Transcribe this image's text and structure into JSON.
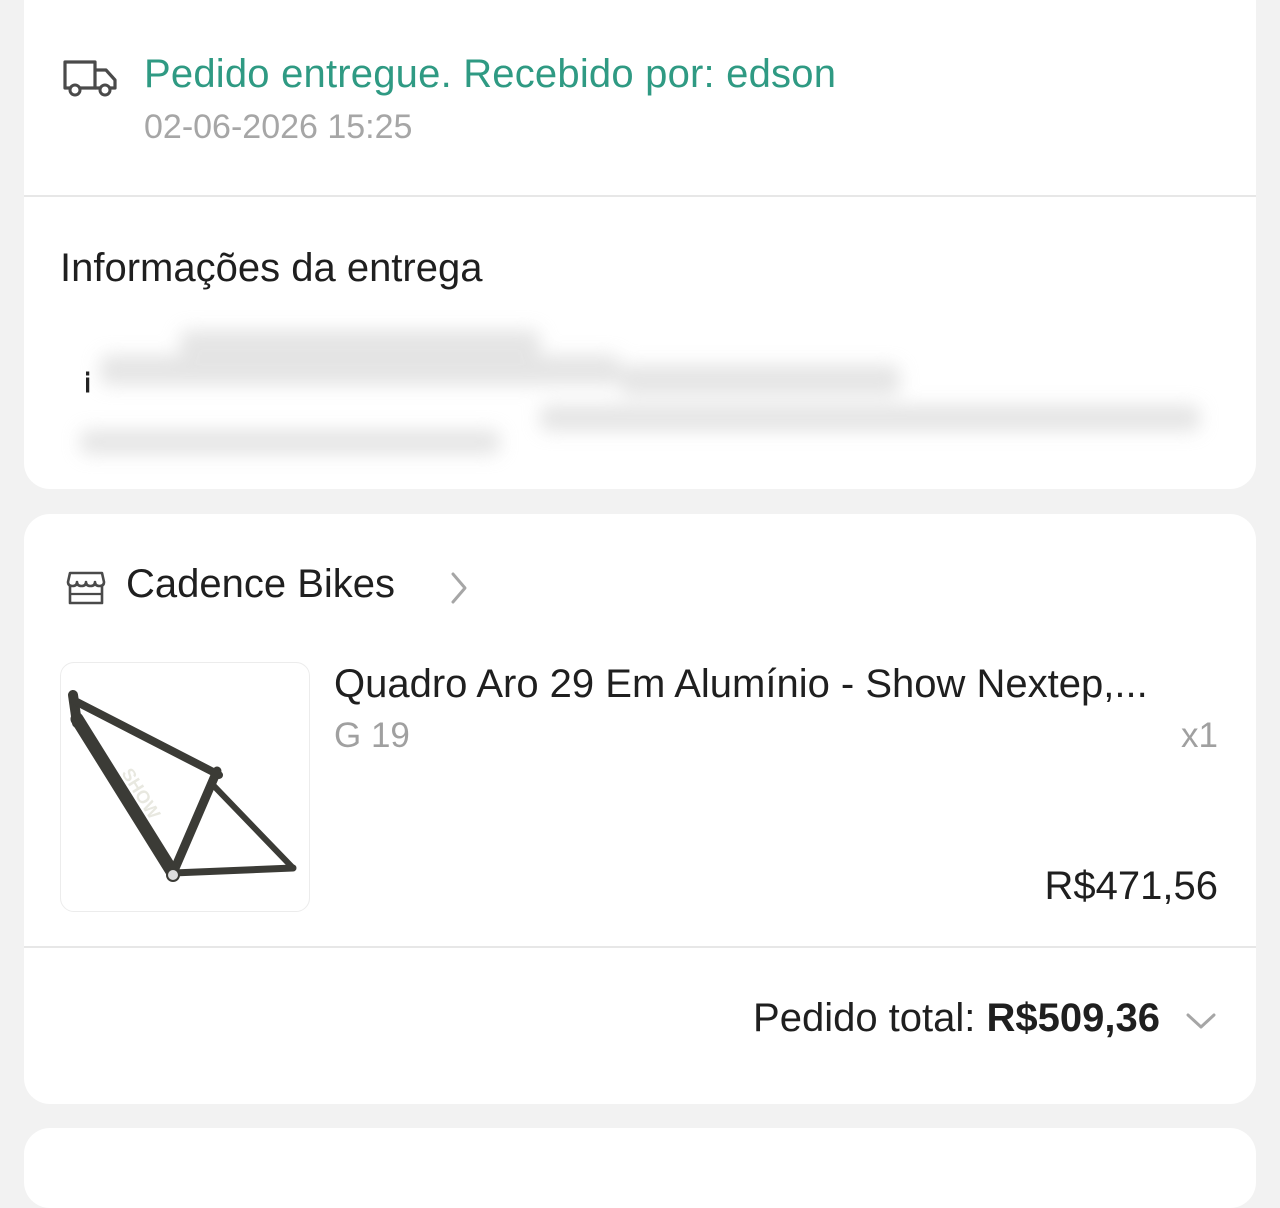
{
  "delivery": {
    "status_text": "Pedido entregue. Recebido por: edson",
    "status_time": "02-06-2026 15:25",
    "status_icon": "truck-icon",
    "section_title": "Informações da entrega"
  },
  "order": {
    "store_icon": "store-icon",
    "store_name": "Cadence Bikes",
    "product": {
      "title": "Quadro Aro 29 Em Alumínio - Show Nextep,...",
      "variant": "G 19",
      "quantity": "x1",
      "price": "R$471,56"
    },
    "total_label": "Pedido total: ",
    "total_value": "R$509,36"
  },
  "colors": {
    "status_green": "#2f9a83",
    "text_dark": "#1f1f1f",
    "text_muted": "#a6a6a6",
    "page_bg": "#f2f2f2"
  }
}
